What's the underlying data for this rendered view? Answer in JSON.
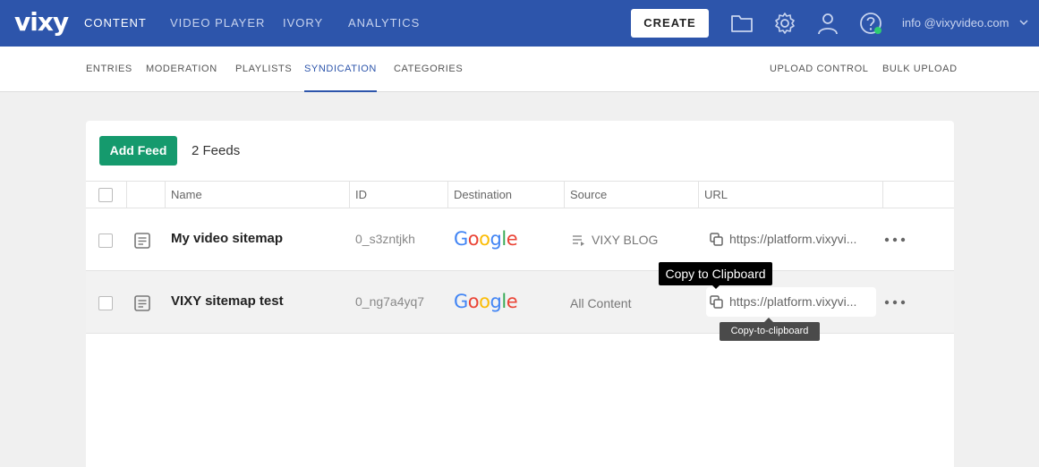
{
  "brand": {
    "logo": "vixy",
    "primary_color": "#2d55ab",
    "accent_color": "#159a6d"
  },
  "topnav": {
    "items": [
      "CONTENT",
      "VIDEO PLAYER",
      "IVORY",
      "ANALYTICS"
    ],
    "active": "CONTENT",
    "create_label": "CREATE",
    "icons": [
      "folder-icon",
      "gear-icon",
      "user-icon",
      "help-icon"
    ],
    "user_email": "info @vixyvideo.com"
  },
  "subnav": {
    "left": [
      "ENTRIES",
      "MODERATION",
      "PLAYLISTS",
      "SYNDICATION",
      "CATEGORIES"
    ],
    "active": "SYNDICATION",
    "right": [
      "UPLOAD CONTROL",
      "BULK UPLOAD"
    ]
  },
  "feeds": {
    "add_label": "Add Feed",
    "count_label": "2 Feeds",
    "columns": [
      "Name",
      "ID",
      "Destination",
      "Source",
      "URL"
    ],
    "rows": [
      {
        "name": "My video sitemap",
        "id": "0_s3zntjkh",
        "destination": "Google",
        "source": "VIXY BLOG",
        "source_icon": "playlist-icon",
        "url": "https://platform.vixyvi..."
      },
      {
        "name": "VIXY sitemap test",
        "id": "0_ng7a4yq7",
        "destination": "Google",
        "source": "All Content",
        "source_icon": "",
        "url": "https://platform.vixyvi..."
      }
    ]
  },
  "tooltips": {
    "copy": "Copy to Clipboard",
    "copy_hint": "Copy-to-clipboard"
  }
}
